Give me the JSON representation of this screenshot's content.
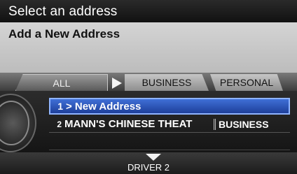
{
  "header": {
    "title": "Select an address"
  },
  "info": {
    "text": "Add a New Address"
  },
  "tabs": [
    {
      "label": "ALL"
    },
    {
      "label": "BUSINESS"
    },
    {
      "label": "PERSONAL"
    }
  ],
  "list": {
    "rows": [
      {
        "num": "1",
        "name": "> New Address",
        "category": ""
      },
      {
        "num": "2",
        "name": "MANN'S CHINESE THEAT",
        "category": "BUSINESS"
      }
    ]
  },
  "footer": {
    "driver": "DRIVER 2"
  },
  "colors": {
    "selected_row": "#2a52b8",
    "panel": "#c9c9c9"
  }
}
